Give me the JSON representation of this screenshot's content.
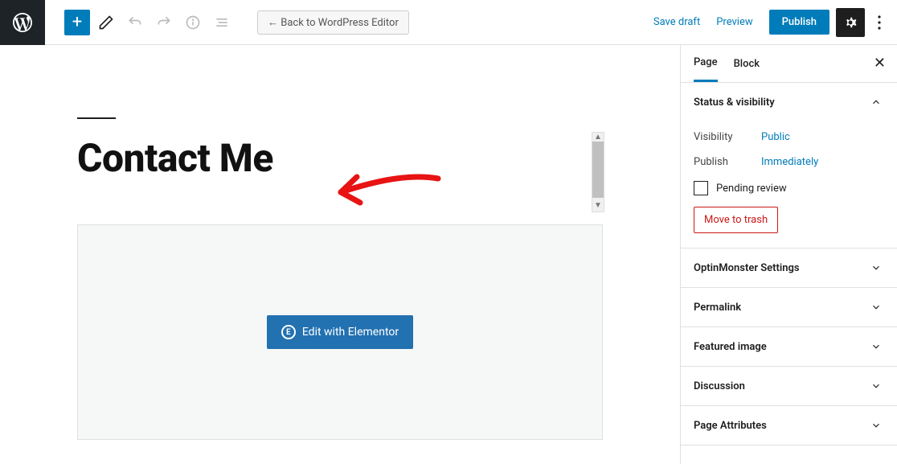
{
  "toolbar": {
    "back_label": "← Back to WordPress Editor",
    "save_draft": "Save draft",
    "preview": "Preview",
    "publish": "Publish"
  },
  "editor": {
    "page_title": "Contact Me",
    "elementor_button": "Edit with Elementor"
  },
  "sidebar": {
    "tabs": {
      "page": "Page",
      "block": "Block"
    },
    "panels": {
      "status": {
        "title": "Status & visibility",
        "visibility_label": "Visibility",
        "visibility_value": "Public",
        "publish_label": "Publish",
        "publish_value": "Immediately",
        "pending_review": "Pending review",
        "move_to_trash": "Move to trash"
      },
      "optinmonster": "OptinMonster Settings",
      "permalink": "Permalink",
      "featured_image": "Featured image",
      "discussion": "Discussion",
      "page_attributes": "Page Attributes"
    }
  }
}
